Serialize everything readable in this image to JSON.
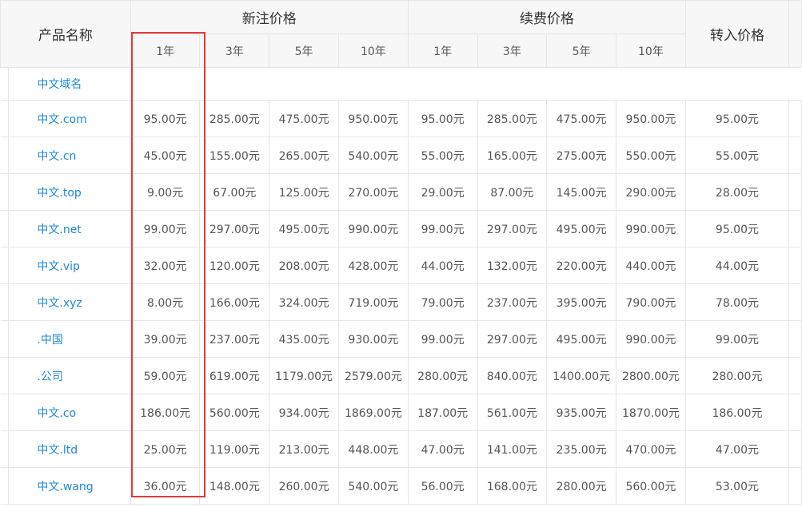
{
  "header": {
    "product_name": "产品名称",
    "new_reg": "新注价格",
    "renew": "续费价格",
    "transfer": "转入价格",
    "new_years": [
      "1年",
      "3年",
      "5年",
      "10年"
    ],
    "renew_years": [
      "1年",
      "3年",
      "5年",
      "10年"
    ]
  },
  "group_label": "中文域名",
  "rows": [
    {
      "name": "中文.com",
      "new": [
        "95.00元",
        "285.00元",
        "475.00元",
        "950.00元"
      ],
      "renew": [
        "95.00元",
        "285.00元",
        "475.00元",
        "950.00元"
      ],
      "transfer": "95.00元"
    },
    {
      "name": "中文.cn",
      "new": [
        "45.00元",
        "155.00元",
        "265.00元",
        "540.00元"
      ],
      "renew": [
        "55.00元",
        "165.00元",
        "275.00元",
        "550.00元"
      ],
      "transfer": "55.00元"
    },
    {
      "name": "中文.top",
      "new": [
        "9.00元",
        "67.00元",
        "125.00元",
        "270.00元"
      ],
      "renew": [
        "29.00元",
        "87.00元",
        "145.00元",
        "290.00元"
      ],
      "transfer": "28.00元"
    },
    {
      "name": "中文.net",
      "new": [
        "99.00元",
        "297.00元",
        "495.00元",
        "990.00元"
      ],
      "renew": [
        "99.00元",
        "297.00元",
        "495.00元",
        "990.00元"
      ],
      "transfer": "95.00元"
    },
    {
      "name": "中文.vip",
      "new": [
        "32.00元",
        "120.00元",
        "208.00元",
        "428.00元"
      ],
      "renew": [
        "44.00元",
        "132.00元",
        "220.00元",
        "440.00元"
      ],
      "transfer": "44.00元"
    },
    {
      "name": "中文.xyz",
      "new": [
        "8.00元",
        "166.00元",
        "324.00元",
        "719.00元"
      ],
      "renew": [
        "79.00元",
        "237.00元",
        "395.00元",
        "790.00元"
      ],
      "transfer": "78.00元"
    },
    {
      "name": ".中国",
      "new": [
        "39.00元",
        "237.00元",
        "435.00元",
        "930.00元"
      ],
      "renew": [
        "99.00元",
        "297.00元",
        "495.00元",
        "990.00元"
      ],
      "transfer": "99.00元"
    },
    {
      "name": ".公司",
      "new": [
        "59.00元",
        "619.00元",
        "1179.00元",
        "2579.00元"
      ],
      "renew": [
        "280.00元",
        "840.00元",
        "1400.00元",
        "2800.00元"
      ],
      "transfer": "280.00元"
    },
    {
      "name": "中文.co",
      "new": [
        "186.00元",
        "560.00元",
        "934.00元",
        "1869.00元"
      ],
      "renew": [
        "187.00元",
        "561.00元",
        "935.00元",
        "1870.00元"
      ],
      "transfer": "186.00元"
    },
    {
      "name": "中文.ltd",
      "new": [
        "25.00元",
        "119.00元",
        "213.00元",
        "448.00元"
      ],
      "renew": [
        "47.00元",
        "141.00元",
        "235.00元",
        "470.00元"
      ],
      "transfer": "47.00元"
    },
    {
      "name": "中文.wang",
      "new": [
        "36.00元",
        "148.00元",
        "260.00元",
        "540.00元"
      ],
      "renew": [
        "56.00元",
        "168.00元",
        "280.00元",
        "560.00元"
      ],
      "transfer": "53.00元"
    }
  ],
  "colors": {
    "link": "#1e88d7",
    "header_bg": "#f7f7f7",
    "border": "#e6e6e6",
    "highlight": "#e53935"
  }
}
